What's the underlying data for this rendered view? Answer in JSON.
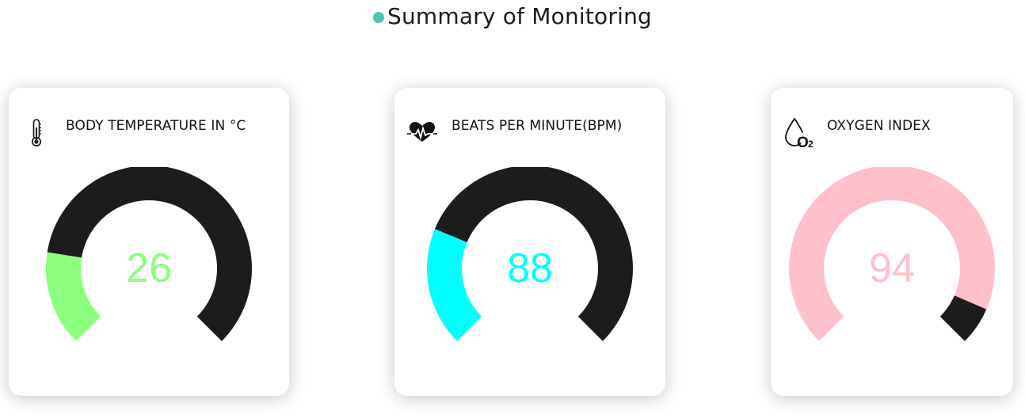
{
  "header": {
    "title": "Summary of Monitoring",
    "dot_color": "#4cc5b5"
  },
  "gauges": [
    {
      "label": "BODY TEMPERATURE IN °C",
      "icon": "thermometer-icon",
      "value": "26",
      "fill_fraction": 0.2,
      "fill_color": "#8aff80",
      "track_color": "#1c1c1c"
    },
    {
      "label": "BEATS PER MINUTE(BPM)",
      "icon": "heartbeat-icon",
      "value": "88",
      "fill_fraction": 0.25,
      "fill_color": "#00ffff",
      "track_color": "#1c1c1c"
    },
    {
      "label": "OXYGEN INDEX",
      "icon": "oxygen-drop-icon",
      "value": "94",
      "fill_fraction": 0.92,
      "fill_color": "#ffc0cb",
      "track_color": "#1c1c1c"
    }
  ]
}
